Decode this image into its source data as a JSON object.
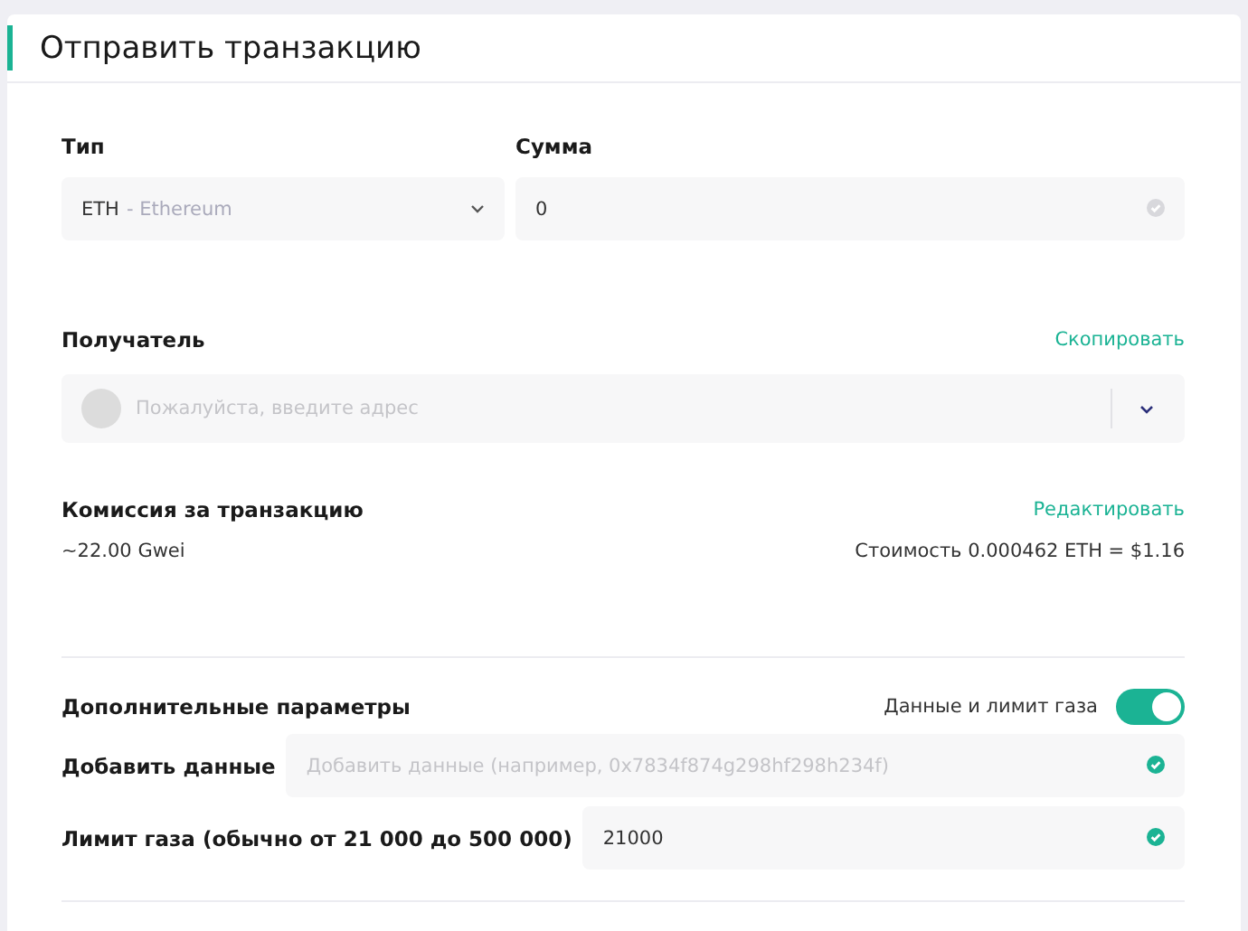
{
  "title": "Отправить транзакцию",
  "type_field": {
    "label": "Тип",
    "code": "ETH",
    "name": "- Ethereum"
  },
  "amount_field": {
    "label": "Сумма",
    "value": "0",
    "valid": false
  },
  "recipient": {
    "label": "Получатель",
    "action": "Скопировать",
    "placeholder": "Пожалуйста, введите адрес"
  },
  "fee": {
    "label": "Комиссия за транзакцию",
    "action": "Редактировать",
    "gas_price": "~22.00 Gwei",
    "cost": "Стоимость 0.000462 ETH = $1.16"
  },
  "advanced": {
    "label": "Дополнительные параметры",
    "toggle_label": "Данные и лимит газа",
    "on": true,
    "fields": [
      {
        "label": "Добавить данные",
        "placeholder": "Добавить данные (например, 0x7834f874g298hf298h234f)",
        "valid": true
      },
      {
        "label": "Лимит газа (обычно от 21 000 до 500 000)",
        "value": "21000",
        "valid": true
      }
    ]
  }
}
